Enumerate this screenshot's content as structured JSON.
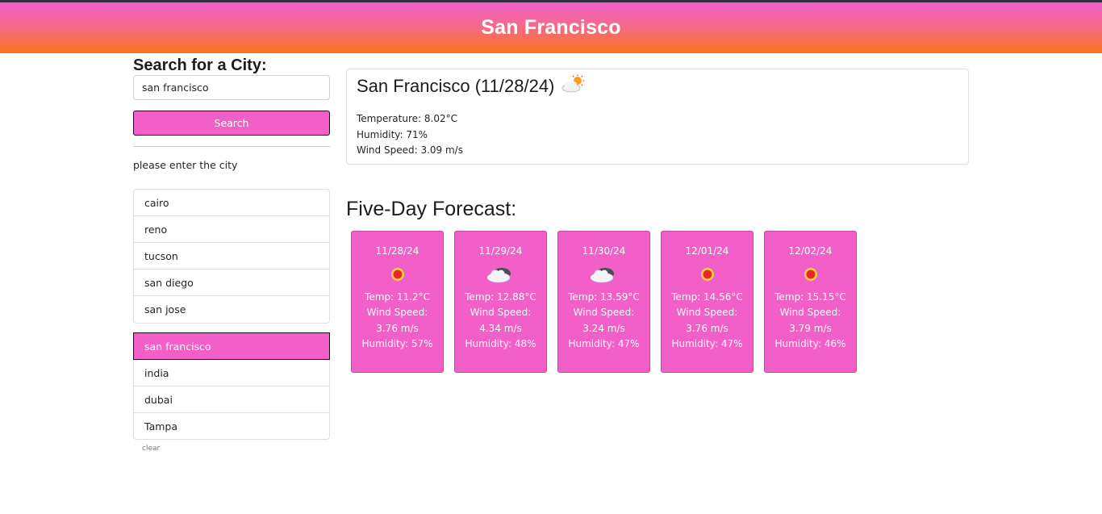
{
  "header": {
    "title": "San Francisco"
  },
  "sidebar": {
    "heading": "Search for a City:",
    "search_value": "san francisco",
    "search_button": "Search",
    "hint": "please enter the city",
    "history_group_1": [
      "cairo",
      "reno",
      "tucson",
      "san diego",
      "san jose"
    ],
    "history_group_2": [
      "san francisco",
      "india",
      "dubai",
      "Tampa"
    ],
    "active_city": "san francisco",
    "clear_label": "clear"
  },
  "current": {
    "title": "San Francisco (11/28/24)",
    "icon": "sun-behind-cloud-icon",
    "temperature": "Temperature: 8.02°C",
    "humidity": "Humidity: 71%",
    "wind": "Wind Speed: 3.09 m/s"
  },
  "forecast": {
    "heading": "Five-Day Forecast:",
    "days": [
      {
        "date": "11/28/24",
        "icon": "sun-icon",
        "temp": "Temp: 11.2°C",
        "wind_label": "Wind Speed:",
        "wind": "3.76 m/s",
        "humidity": "Humidity: 57%"
      },
      {
        "date": "11/29/24",
        "icon": "cloud-icon",
        "temp": "Temp: 12.88°C",
        "wind_label": "Wind Speed:",
        "wind": "4.34 m/s",
        "humidity": "Humidity: 48%"
      },
      {
        "date": "11/30/24",
        "icon": "cloud-icon",
        "temp": "Temp: 13.59°C",
        "wind_label": "Wind Speed:",
        "wind": "3.24 m/s",
        "humidity": "Humidity: 47%"
      },
      {
        "date": "12/01/24",
        "icon": "sun-icon",
        "temp": "Temp: 14.56°C",
        "wind_label": "Wind Speed:",
        "wind": "3.76 m/s",
        "humidity": "Humidity: 47%"
      },
      {
        "date": "12/02/24",
        "icon": "sun-icon",
        "temp": "Temp: 15.15°C",
        "wind_label": "Wind Speed:",
        "wind": "3.79 m/s",
        "humidity": "Humidity: 46%"
      }
    ]
  },
  "colors": {
    "accent_pink": "#f25fc8",
    "header_gradient_top": "#f25fc8",
    "header_gradient_bottom": "#f7721e"
  }
}
